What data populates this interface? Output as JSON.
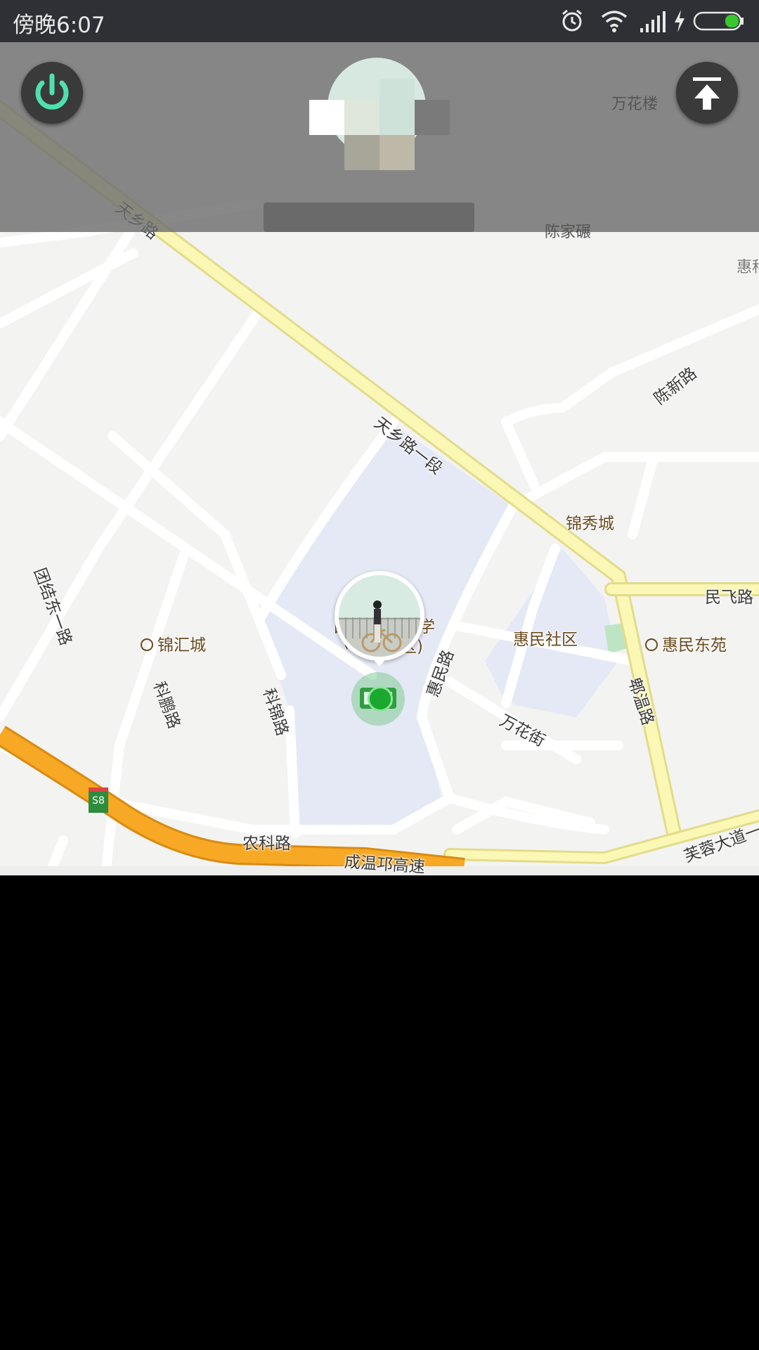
{
  "status_bar": {
    "time": "傍晚6:07"
  },
  "map": {
    "road_labels": {
      "tianxiang_road": "天乡路",
      "tianxiang_road_section1": "天乡路一段",
      "chenxin_road": "陈新路",
      "tuanjie_east_road": "团结东一路",
      "kehuai_road": "科鹏路",
      "kejin_road": "科锦路",
      "huimin_road": "惠民路",
      "wanhua_street": "万花街",
      "pixian_road": "郫温路",
      "minfei_road": "民飞路",
      "nongke_road": "农科路",
      "chengwen_expressway": "成温邛高速",
      "furong_avenue": "芙蓉大道一",
      "highway_shield": "S8"
    },
    "place_labels": {
      "jinxiucheng": "锦秀城",
      "huimin_community": "惠民社区",
      "huimin_dongyuan": "惠民东苑",
      "jinhuicheng": "锦汇城",
      "campus_left": "日",
      "campus_right": "学",
      "campus_sub_left": "(",
      "campus_sub_right": "区)",
      "chenjiawan": "陈家碾",
      "hui_edge": "惠科"
    },
    "overlay": {
      "wanhualou": "万花楼"
    },
    "colors": {
      "background": "#f3f3f2",
      "main_road": "#fbf7b4",
      "expressway": "#f7a824",
      "campus_area": "#e4e9f5",
      "location_dot": "#1aa82e",
      "power_accent": "#4fe0b0"
    }
  }
}
